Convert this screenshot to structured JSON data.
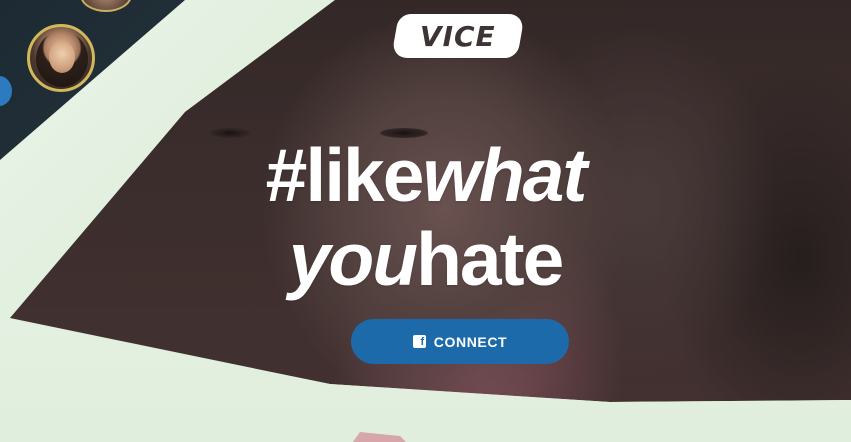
{
  "logo": {
    "text": "VICE"
  },
  "headline": {
    "line1_regular": "#like",
    "line1_italic": "what",
    "line2_italic": "you",
    "line2_regular": "hate"
  },
  "connect_button": {
    "label": "CONNECT",
    "icon": "facebook-icon"
  },
  "colors": {
    "button": "#1c6aa9",
    "background": "#e4f0e3",
    "text": "#ffffff"
  }
}
